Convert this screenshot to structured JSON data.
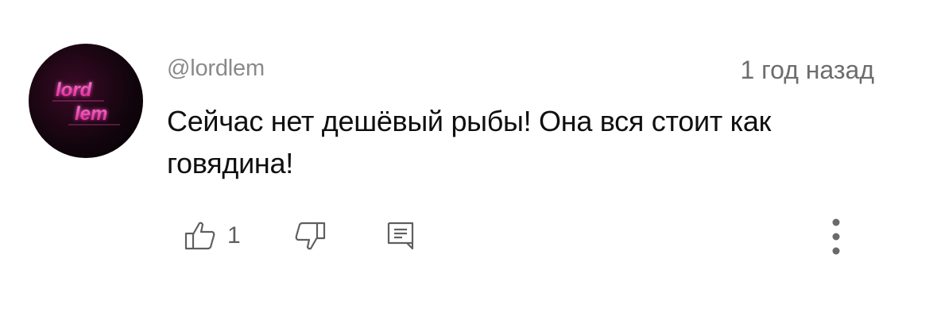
{
  "comment": {
    "author": "@lordlem",
    "timestamp": "1 год назад",
    "text": "Сейчас нет дешёвый рыбы! Она вся стоит как говядина!",
    "avatar_logo_text": "lord lem",
    "like_count": "1"
  },
  "icons": {
    "like": "thumb-up-icon",
    "dislike": "thumb-down-icon",
    "reply": "comment-reply-icon",
    "more": "more-vertical-icon"
  },
  "colors": {
    "avatar_accent": "#ff2fb0",
    "text_primary": "#0f0f0f",
    "text_secondary": "#6d6d6d"
  }
}
